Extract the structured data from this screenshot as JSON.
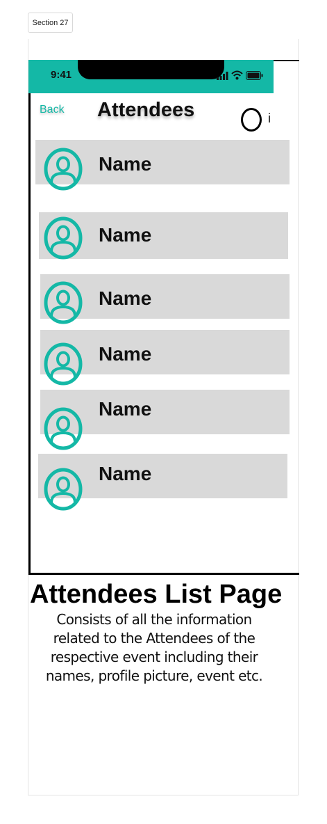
{
  "section": {
    "label": "Section 27"
  },
  "status_bar": {
    "time": "9:41"
  },
  "header": {
    "back_label": "Back",
    "title": "Attendees",
    "info_label": "i"
  },
  "attendees": [
    {
      "name": "Name"
    },
    {
      "name": "Name"
    },
    {
      "name": "Name"
    },
    {
      "name": "Name"
    },
    {
      "name": "Name"
    },
    {
      "name": "Name"
    }
  ],
  "description": {
    "heading": "Attendees List Page",
    "body": "Consists of all the information related to the Attendees of the respective event including their names, profile picture, event etc."
  },
  "colors": {
    "accent": "#14b8a6",
    "row_bg": "#d9d9d9"
  }
}
